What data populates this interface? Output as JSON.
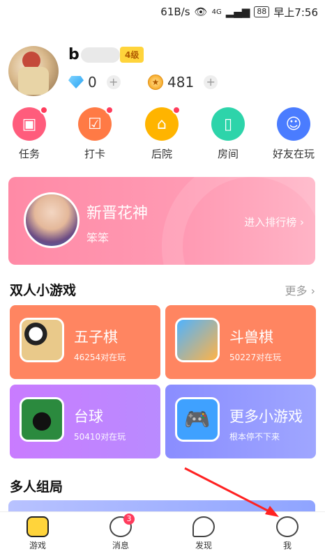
{
  "status_bar": {
    "speed": "61B/s",
    "network": "4G",
    "battery": "88",
    "time": "早上7:56"
  },
  "profile": {
    "username": "b",
    "level": "4级",
    "diamonds": "0",
    "coins": "481",
    "plus": "+"
  },
  "quick_actions": [
    {
      "label": "任务",
      "color": "#ff5c7c",
      "glyph": "🎁"
    },
    {
      "label": "打卡",
      "color": "#ff7a45",
      "glyph": "📅"
    },
    {
      "label": "后院",
      "color": "#ffb400",
      "glyph": "🏠"
    },
    {
      "label": "房间",
      "color": "#2dd4aa",
      "glyph": "🚪"
    },
    {
      "label": "好友在玩",
      "color": "#4a7cff",
      "glyph": "👤"
    }
  ],
  "banner": {
    "title": "新晋花神",
    "subtitle": "笨笨",
    "link": "进入排行榜 ›"
  },
  "sections": {
    "duo_games": {
      "title": "双人小游戏",
      "more": "更多 ›"
    },
    "multi_games": {
      "title": "多人组局"
    }
  },
  "games": [
    {
      "name": "五子棋",
      "sub": "46254对在玩",
      "bg": "#ff8561"
    },
    {
      "name": "斗兽棋",
      "sub": "50227对在玩",
      "bg": "#ff8561"
    },
    {
      "name": "台球",
      "sub": "50410对在玩",
      "bg": "#c97bff"
    },
    {
      "name": "更多小游戏",
      "sub": "根本停不下来",
      "bg": "#8a8dff"
    }
  ],
  "bottom_nav": [
    {
      "label": "游戏"
    },
    {
      "label": "消息",
      "badge": "3"
    },
    {
      "label": "发现"
    },
    {
      "label": "我"
    }
  ]
}
